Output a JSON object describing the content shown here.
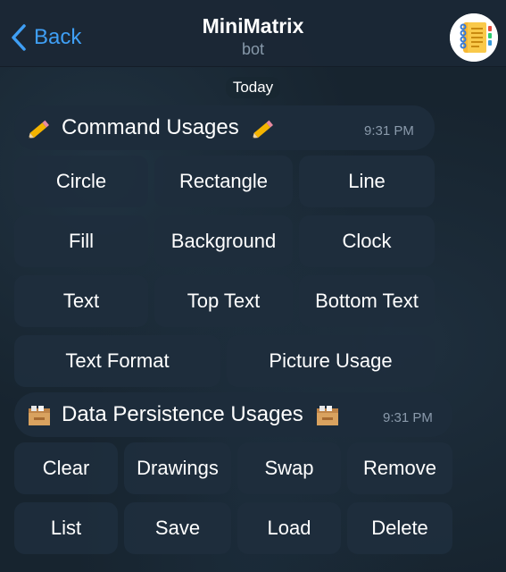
{
  "header": {
    "back_label": "Back",
    "title": "MiniMatrix",
    "subtitle": "bot"
  },
  "chat": {
    "date": "Today",
    "messages": [
      {
        "text": "Command Usages",
        "emoji": "pencil-icon",
        "time": "9:31 PM",
        "buttons": [
          [
            "Circle",
            "Rectangle",
            "Line"
          ],
          [
            "Fill",
            "Background",
            "Clock"
          ],
          [
            "Text",
            "Top Text",
            "Bottom Text"
          ],
          [
            "Text Format",
            "Picture Usage"
          ]
        ]
      },
      {
        "text": "Data Persistence Usages",
        "emoji": "card-box-icon",
        "time": "9:31 PM",
        "buttons": [
          [
            "Clear",
            "Drawings",
            "Swap",
            "Remove"
          ],
          [
            "List",
            "Save",
            "Load",
            "Delete"
          ]
        ]
      }
    ]
  },
  "colors": {
    "accent": "#3f9ff5",
    "background": "#16232f",
    "bubble": "#1d2c3b",
    "button": "#1e2e3d"
  }
}
